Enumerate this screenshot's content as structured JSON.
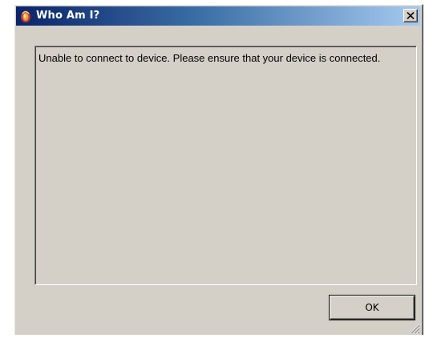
{
  "window": {
    "title": "Who Am I?",
    "icon": "app-logo-icon"
  },
  "titlebar": {
    "close_icon": "close-icon",
    "gradient_start": "#0a246a",
    "gradient_end": "#a6caf0"
  },
  "message": {
    "text": "Unable to connect to device. Please ensure that your device is connected."
  },
  "buttons": {
    "ok_label": "OK"
  },
  "colors": {
    "face": "#d4d0c8",
    "title_text": "#ffffff"
  }
}
